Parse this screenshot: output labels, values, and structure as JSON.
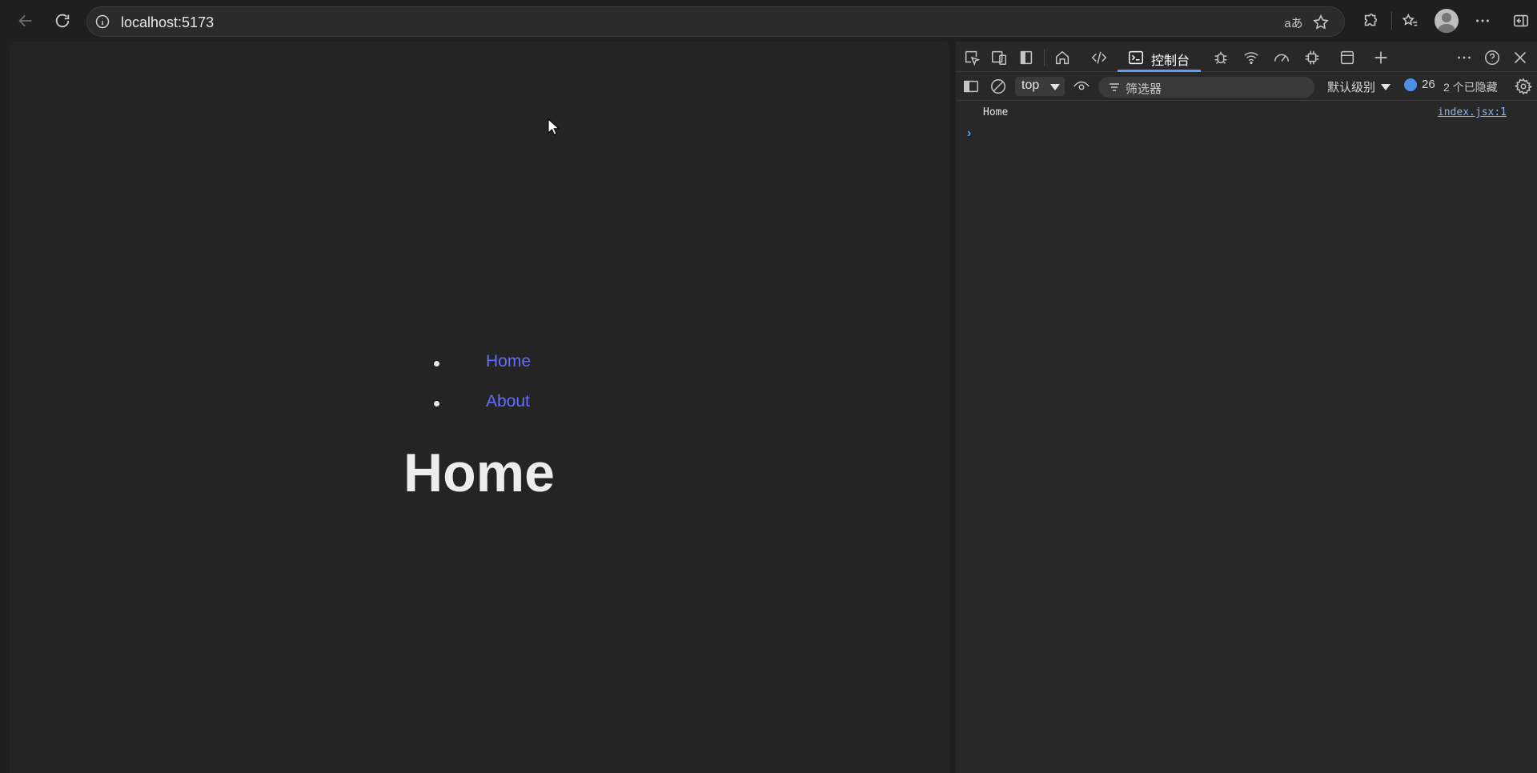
{
  "browser": {
    "url": "localhost:5173",
    "translate_glyph": "aあ"
  },
  "page": {
    "nav": [
      {
        "label": "Home"
      },
      {
        "label": "About"
      }
    ],
    "title": "Home",
    "link_color": "#646cff"
  },
  "devtools": {
    "active_tab": "控制台",
    "context": "top",
    "filter_placeholder": "筛选器",
    "level": "默认级别",
    "issues_count": "26",
    "hidden": "2 个已隐藏",
    "logs": [
      {
        "message": "Home",
        "source": "index.jsx:1"
      }
    ],
    "prompt_glyph": "›"
  }
}
